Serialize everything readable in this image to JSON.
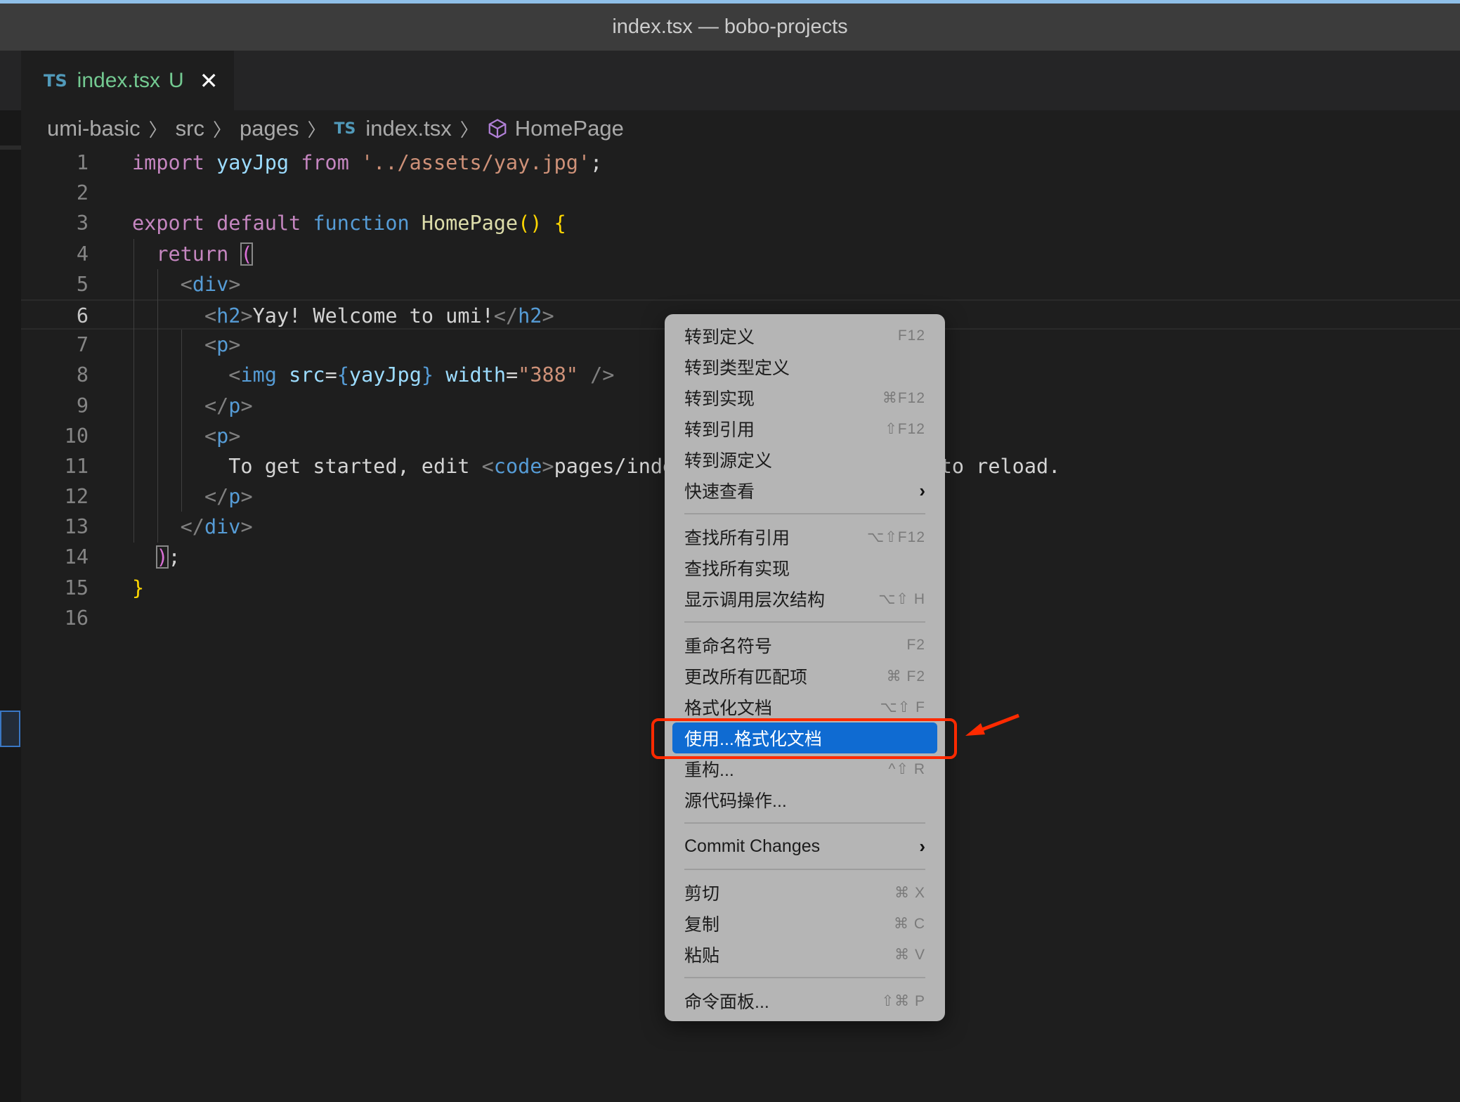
{
  "window": {
    "title": "index.tsx — bobo-projects"
  },
  "tab": {
    "lang": "TS",
    "name": "index.tsx",
    "status": "U",
    "close": "✕"
  },
  "breadcrumb": {
    "items": [
      "umi-basic",
      "src",
      "pages"
    ],
    "file_lang": "TS",
    "file": "index.tsx",
    "symbol": "HomePage",
    "symbol_icon": "cube-icon"
  },
  "editor": {
    "current_line": 6,
    "lines": [
      {
        "n": "1",
        "tokens": [
          [
            "import ",
            "k"
          ],
          [
            "yayJpg ",
            "v"
          ],
          [
            "from ",
            "k"
          ],
          [
            "'../assets/yay.jpg'",
            "s"
          ],
          [
            ";",
            "txt"
          ]
        ]
      },
      {
        "n": "2",
        "tokens": []
      },
      {
        "n": "3",
        "tokens": [
          [
            "export ",
            "k"
          ],
          [
            "default ",
            "k"
          ],
          [
            "function ",
            "b"
          ],
          [
            "HomePage",
            "f"
          ],
          [
            "() ",
            "y"
          ],
          [
            "{",
            "y"
          ]
        ]
      },
      {
        "n": "4",
        "tokens": [
          [
            "  return ",
            "k"
          ],
          [
            "(",
            "bm p"
          ]
        ]
      },
      {
        "n": "5",
        "tokens": [
          [
            "    ",
            "txt"
          ],
          [
            "<",
            "g"
          ],
          [
            "div",
            "t"
          ],
          [
            ">",
            "g"
          ]
        ]
      },
      {
        "n": "6",
        "tokens": [
          [
            "      ",
            "txt"
          ],
          [
            "<",
            "g"
          ],
          [
            "h2",
            "t"
          ],
          [
            ">",
            "g"
          ],
          [
            "Yay! Welcome to umi!",
            "txt"
          ],
          [
            "</",
            "g"
          ],
          [
            "h2",
            "t"
          ],
          [
            ">",
            "g"
          ]
        ]
      },
      {
        "n": "7",
        "tokens": [
          [
            "      ",
            "txt"
          ],
          [
            "<",
            "g"
          ],
          [
            "p",
            "t"
          ],
          [
            ">",
            "g"
          ]
        ]
      },
      {
        "n": "8",
        "tokens": [
          [
            "        ",
            "txt"
          ],
          [
            "<",
            "g"
          ],
          [
            "img ",
            "t"
          ],
          [
            "src",
            "v"
          ],
          [
            "=",
            "txt"
          ],
          [
            "{",
            "b"
          ],
          [
            "yayJpg",
            "v"
          ],
          [
            "} ",
            "b"
          ],
          [
            "width",
            "v"
          ],
          [
            "=",
            "txt"
          ],
          [
            "\"388\"",
            "s"
          ],
          [
            " />",
            "g"
          ]
        ]
      },
      {
        "n": "9",
        "tokens": [
          [
            "      ",
            "txt"
          ],
          [
            "</",
            "g"
          ],
          [
            "p",
            "t"
          ],
          [
            ">",
            "g"
          ]
        ]
      },
      {
        "n": "10",
        "tokens": [
          [
            "      ",
            "txt"
          ],
          [
            "<",
            "g"
          ],
          [
            "p",
            "t"
          ],
          [
            ">",
            "g"
          ]
        ]
      },
      {
        "n": "11",
        "tokens": [
          [
            "        To get started, edit ",
            "txt"
          ],
          [
            "<",
            "g"
          ],
          [
            "code",
            "t"
          ],
          [
            ">",
            "g"
          ],
          [
            "pages/index.tsx",
            "txt"
          ],
          [
            "</",
            "g"
          ],
          [
            "code",
            "t"
          ],
          [
            ">",
            "g"
          ],
          [
            " and save to reload.",
            "txt"
          ]
        ]
      },
      {
        "n": "12",
        "tokens": [
          [
            "      ",
            "txt"
          ],
          [
            "</",
            "g"
          ],
          [
            "p",
            "t"
          ],
          [
            ">",
            "g"
          ]
        ]
      },
      {
        "n": "13",
        "tokens": [
          [
            "    ",
            "txt"
          ],
          [
            "</",
            "g"
          ],
          [
            "div",
            "t"
          ],
          [
            ">",
            "g"
          ]
        ]
      },
      {
        "n": "14",
        "tokens": [
          [
            "  ",
            "txt"
          ],
          [
            ")",
            "bm p"
          ],
          [
            ";",
            "txt"
          ]
        ]
      },
      {
        "n": "15",
        "tokens": [
          [
            "}",
            "y"
          ]
        ]
      },
      {
        "n": "16",
        "tokens": []
      }
    ]
  },
  "context_menu": {
    "highlight_color": "#0f6bd2",
    "annotation_color": "#ff2a00",
    "groups": [
      [
        {
          "label": "转到定义",
          "shortcut": "F12"
        },
        {
          "label": "转到类型定义",
          "shortcut": ""
        },
        {
          "label": "转到实现",
          "shortcut": "⌘F12"
        },
        {
          "label": "转到引用",
          "shortcut": "⇧F12"
        },
        {
          "label": "转到源定义",
          "shortcut": ""
        },
        {
          "label": "快速查看",
          "submenu": true
        }
      ],
      [
        {
          "label": "查找所有引用",
          "shortcut": "⌥⇧F12"
        },
        {
          "label": "查找所有实现",
          "shortcut": ""
        },
        {
          "label": "显示调用层次结构",
          "shortcut": "⌥⇧ H"
        }
      ],
      [
        {
          "label": "重命名符号",
          "shortcut": "F2"
        },
        {
          "label": "更改所有匹配项",
          "shortcut": "⌘ F2"
        },
        {
          "label": "格式化文档",
          "shortcut": "⌥⇧ F"
        },
        {
          "label": "使用...格式化文档",
          "shortcut": "",
          "highlighted": true
        },
        {
          "label": "重构...",
          "shortcut": "^⇧ R"
        },
        {
          "label": "源代码操作...",
          "shortcut": ""
        }
      ],
      [
        {
          "label": "Commit Changes",
          "submenu": true
        }
      ],
      [
        {
          "label": "剪切",
          "shortcut": "⌘ X"
        },
        {
          "label": "复制",
          "shortcut": "⌘ C"
        },
        {
          "label": "粘贴",
          "shortcut": "⌘ V"
        }
      ],
      [
        {
          "label": "命令面板...",
          "shortcut": "⇧⌘ P"
        }
      ]
    ]
  }
}
